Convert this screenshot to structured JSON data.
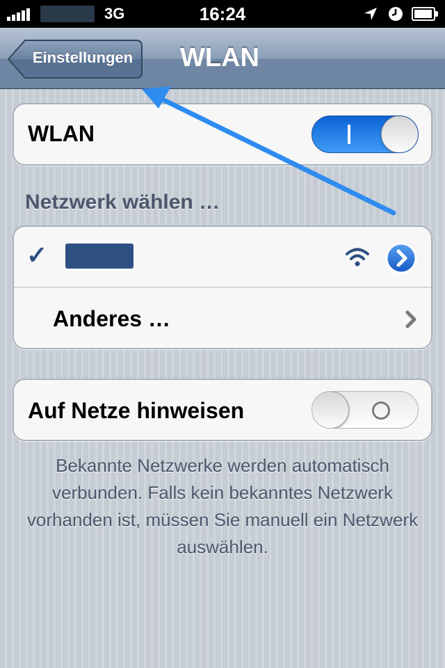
{
  "status_bar": {
    "network_type": "3G",
    "time": "16:24",
    "signal_bars": 5,
    "battery_level": 0.95
  },
  "nav_bar": {
    "back_label": "Einstellungen",
    "title": "WLAN"
  },
  "wlan_group": {
    "label": "WLAN",
    "switch_state": "on",
    "switch_on_text": "I"
  },
  "network_section": {
    "header": "Netzwerk wählen …",
    "networks": [
      {
        "name": "",
        "selected": true,
        "checkmark": "✓",
        "signal_icon": "wifi-icon",
        "detail_icon": "detail-disclosure-icon"
      }
    ],
    "other": {
      "label": "Anderes …",
      "icon": "chevron-right-icon"
    }
  },
  "ask_group": {
    "label": "Auf Netze hinweisen",
    "switch_state": "off"
  },
  "footer_note": "Bekannte Netzwerke werden automatisch verbunden. Falls kein bekanntes Netzwerk vorhanden ist, müssen Sie manuell ein Netzwerk auswählen.",
  "colors": {
    "accent_blue": "#1b73e0",
    "nav_bar": "#7f94ae",
    "section_text": "#4c566c",
    "annotation_arrow": "#2e8cf0"
  }
}
